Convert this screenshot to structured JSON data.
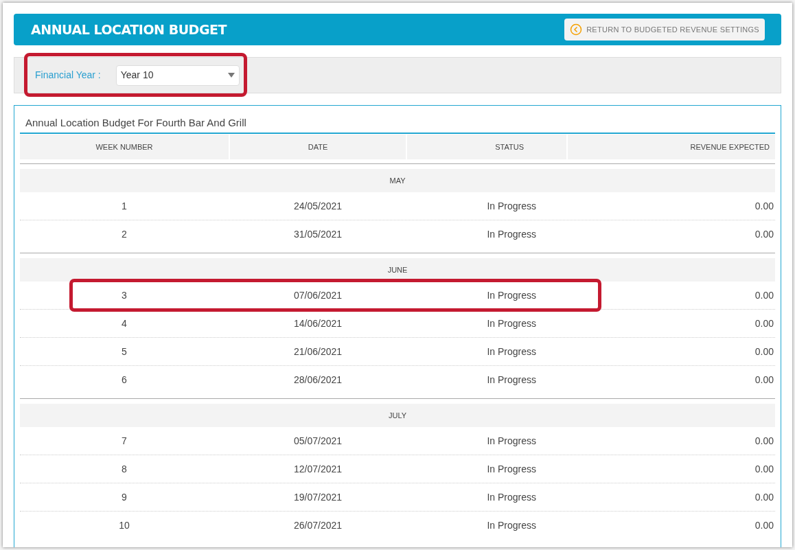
{
  "header": {
    "title": "ANNUAL LOCATION BUDGET",
    "return_button": "RETURN TO BUDGETED REVENUE SETTINGS"
  },
  "filter": {
    "label": "Financial Year :",
    "value": "Year 10",
    "highlighted": true
  },
  "table": {
    "title": "Annual Location Budget For Fourth Bar And Grill",
    "columns": [
      "WEEK NUMBER",
      "DATE",
      "STATUS",
      "REVENUE EXPECTED"
    ],
    "groups": [
      {
        "month": "MAY",
        "rows": [
          {
            "week": "1",
            "date": "24/05/2021",
            "status": "In Progress",
            "revenue": "0.00",
            "highlighted": false
          },
          {
            "week": "2",
            "date": "31/05/2021",
            "status": "In Progress",
            "revenue": "0.00",
            "highlighted": false
          }
        ]
      },
      {
        "month": "JUNE",
        "rows": [
          {
            "week": "3",
            "date": "07/06/2021",
            "status": "In Progress",
            "revenue": "0.00",
            "highlighted": true
          },
          {
            "week": "4",
            "date": "14/06/2021",
            "status": "In Progress",
            "revenue": "0.00",
            "highlighted": false
          },
          {
            "week": "5",
            "date": "21/06/2021",
            "status": "In Progress",
            "revenue": "0.00",
            "highlighted": false
          },
          {
            "week": "6",
            "date": "28/06/2021",
            "status": "In Progress",
            "revenue": "0.00",
            "highlighted": false
          }
        ]
      },
      {
        "month": "JULY",
        "rows": [
          {
            "week": "7",
            "date": "05/07/2021",
            "status": "In Progress",
            "revenue": "0.00",
            "highlighted": false
          },
          {
            "week": "8",
            "date": "12/07/2021",
            "status": "In Progress",
            "revenue": "0.00",
            "highlighted": false
          },
          {
            "week": "9",
            "date": "19/07/2021",
            "status": "In Progress",
            "revenue": "0.00",
            "highlighted": false
          },
          {
            "week": "10",
            "date": "26/07/2021",
            "status": "In Progress",
            "revenue": "0.00",
            "highlighted": false
          }
        ]
      }
    ]
  }
}
